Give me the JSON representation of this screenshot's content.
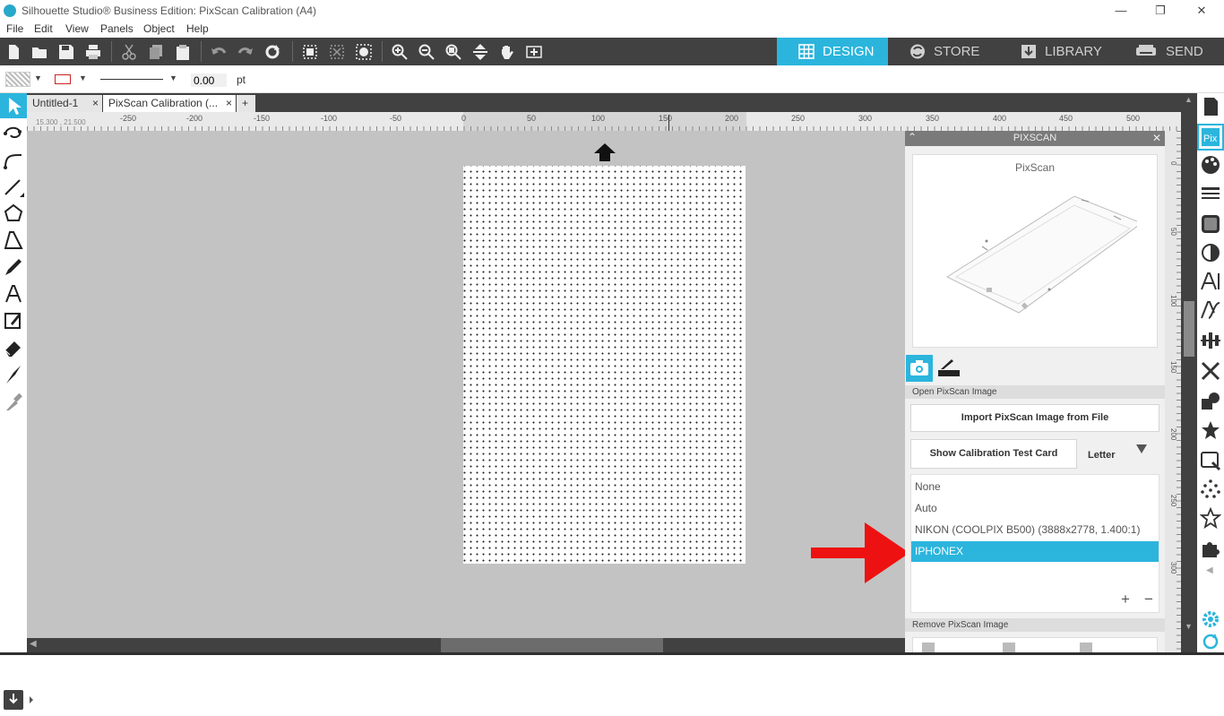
{
  "window": {
    "title": "Silhouette Studio® Business Edition: PixScan Calibration (A4)",
    "minimize": "—",
    "restore": "❐",
    "close": "✕"
  },
  "menu": [
    "File",
    "Edit",
    "View",
    "Panels",
    "Object",
    "Help"
  ],
  "nav_tabs": [
    {
      "label": "DESIGN",
      "icon": "grid-icon",
      "active": true
    },
    {
      "label": "STORE",
      "icon": "store-icon",
      "active": false
    },
    {
      "label": "LIBRARY",
      "icon": "library-icon",
      "active": false
    },
    {
      "label": "SEND",
      "icon": "send-icon",
      "active": false
    }
  ],
  "options_bar": {
    "line_width": "0.00",
    "line_unit": "pt"
  },
  "doc_tabs": [
    {
      "label": "Untitled-1",
      "close": "×"
    },
    {
      "label": "PixScan Calibration (...",
      "close": "×"
    }
  ],
  "add_tab": "+",
  "cursor_coords": "15.300 , 21.500",
  "ruler_h_labels": [
    "-250",
    "-200",
    "-150",
    "-100",
    "-50",
    "0",
    "50",
    "100",
    "150",
    "200",
    "250",
    "300",
    "350",
    "400",
    "450",
    "500"
  ],
  "ruler_v_labels": [
    "0",
    "50",
    "100",
    "150",
    "200",
    "250",
    "300"
  ],
  "panel": {
    "title": "PIXSCAN",
    "preview_title": "PixScan",
    "open_section": "Open PixScan Image",
    "import_button": "Import PixScan Image from File",
    "calibration_button": "Show Calibration Test Card",
    "card_size": "Letter",
    "calibrations": [
      {
        "label": "None",
        "selected": false
      },
      {
        "label": "Auto",
        "selected": false
      },
      {
        "label": "NIKON (COOLPIX B500) (3888x2778, 1.400:1)",
        "selected": false
      },
      {
        "label": "IPHONEX",
        "selected": true
      }
    ],
    "add_label": "+",
    "remove_label": "−",
    "remove_section": "Remove PixScan Image"
  },
  "colors": {
    "accent": "#2bb5dd",
    "toolbar_bg": "#414141",
    "canvas_bg": "#c3c3c3",
    "annotation_arrow": "#ee1111"
  }
}
